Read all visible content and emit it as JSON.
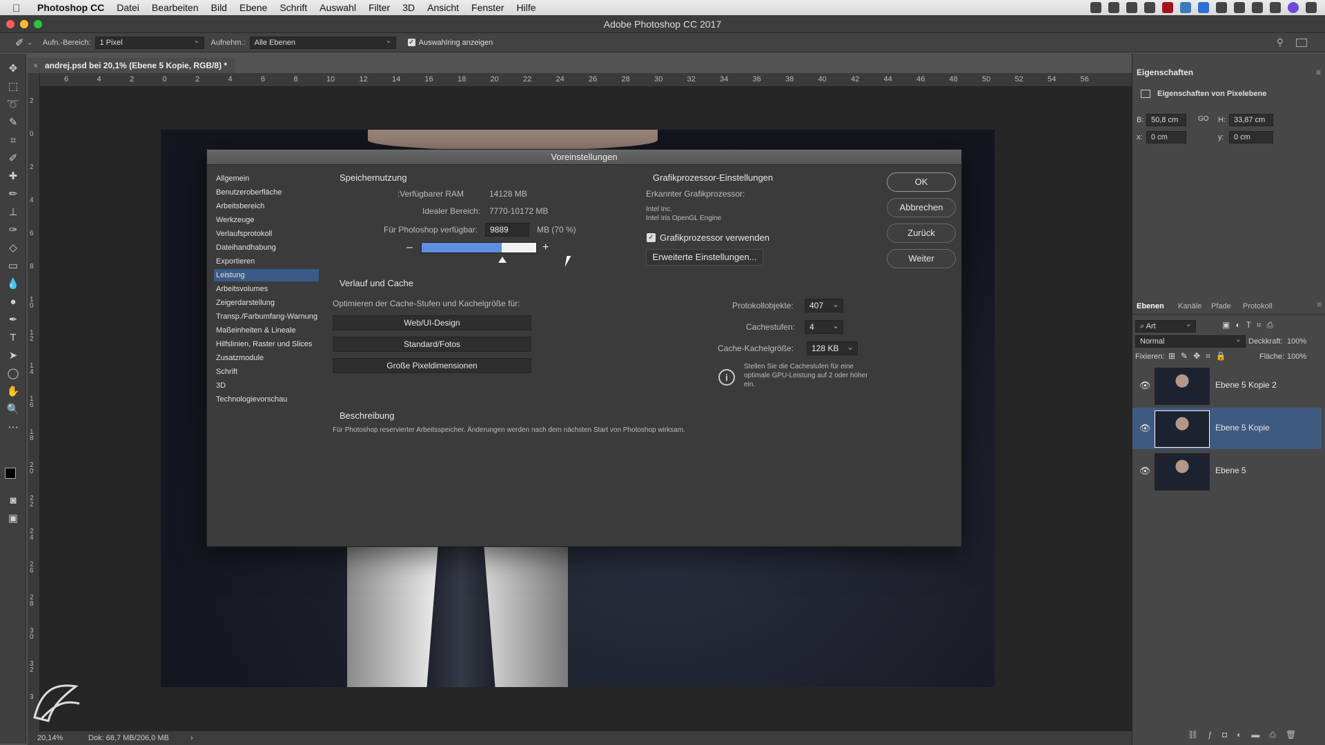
{
  "menubar": {
    "app": "Photoshop CC",
    "items": [
      "Datei",
      "Bearbeiten",
      "Bild",
      "Ebene",
      "Schrift",
      "Auswahl",
      "Filter",
      "3D",
      "Ansicht",
      "Fenster",
      "Hilfe"
    ]
  },
  "window": {
    "title": "Adobe Photoshop CC 2017"
  },
  "options": {
    "sample_size_label": "Aufn.-Bereich:",
    "sample_size_value": "1 Pixel",
    "sample_label": "Aufnehm.:",
    "sample_value": "Alle Ebenen",
    "show_ring_label": "Auswahlring anzeigen"
  },
  "document": {
    "tab": "andrej.psd bei 20,1% (Ebene 5 Kopie, RGB/8) *"
  },
  "ruler_top": [
    "6",
    "4",
    "2",
    "0",
    "2",
    "4",
    "6",
    "8",
    "10",
    "12",
    "14",
    "16",
    "18",
    "20",
    "22",
    "24",
    "26",
    "28",
    "30",
    "32",
    "34",
    "36",
    "38",
    "40",
    "42",
    "44",
    "46",
    "48",
    "50",
    "52",
    "54",
    "56"
  ],
  "ruler_left": [
    "2",
    "0",
    "2",
    "4",
    "6",
    "8",
    "1\n0",
    "1\n2",
    "1\n4",
    "1\n6",
    "1\n8",
    "2\n0",
    "2\n2",
    "2\n4",
    "2\n6",
    "2\n8",
    "3\n0",
    "3\n2",
    "3"
  ],
  "status": {
    "zoom": "20,14%",
    "doc": "Dok: 68,7 MB/206,0 MB",
    "arrow": "›"
  },
  "properties": {
    "title": "Eigenschaften",
    "subtitle": "Eigenschaften von Pixelebene",
    "w_label": "B:",
    "w_value": "50,8 cm",
    "h_label": "H:",
    "h_value": "33,87 cm",
    "x_label": "x:",
    "x_value": "0 cm",
    "y_label": "y:",
    "y_value": "0 cm",
    "link_symbol": "GO"
  },
  "layers_panel": {
    "tabs": [
      "Ebenen",
      "Kanäle",
      "Pfade",
      "Protokoll"
    ],
    "filter": "Art",
    "blend_mode": "Normal",
    "opacity_label": "Deckkraft:",
    "opacity_value": "100%",
    "lock_label": "Fixieren:",
    "fill_label": "Fläche:",
    "fill_value": "100%",
    "layers": [
      {
        "name": "Ebene 5 Kopie 2",
        "selected": false
      },
      {
        "name": "Ebene 5 Kopie",
        "selected": true
      },
      {
        "name": "Ebene 5",
        "selected": false
      }
    ]
  },
  "dialog": {
    "title": "Voreinstellungen",
    "nav": [
      "Allgemein",
      "Benutzeroberfläche",
      "Arbeitsbereich",
      "Werkzeuge",
      "Verlaufsprotokoll",
      "Dateihandhabung",
      "Exportieren",
      "Leistung",
      "Arbeitsvolumes",
      "Zeigerdarstellung",
      "Transp./Farbumfang-Warnung",
      "Maßeinheiten & Lineale",
      "Hilfslinien, Raster und Slices",
      "Zusatzmodule",
      "Schrift",
      "3D",
      "Technologievorschau"
    ],
    "active_nav": "Leistung",
    "memory": {
      "header": "Speichernutzung",
      "ram_label": "Verfügbarer RAM:",
      "ram_value": "14128 MB",
      "ideal_label": "Idealer Bereich:",
      "ideal_value": "7770-10172 MB",
      "ps_label": "Für Photoshop verfügbar:",
      "ps_value": "9889",
      "ps_unit": "MB (70 %)",
      "slider_fraction": 0.7,
      "minus": "–",
      "plus": "+"
    },
    "gpu": {
      "header": "Grafikprozessor-Einstellungen",
      "detected_label": "Erkannter Grafikprozessor:",
      "vendor": "Intel Inc.",
      "engine": "Intel Iris OpenGL Engine",
      "use_label": "Grafikprozessor verwenden",
      "advanced_button": "Erweiterte Einstellungen..."
    },
    "history": {
      "header": "Verlauf und Cache",
      "optimize_label": "Optimieren der Cache-Stufen und Kachelgröße für:",
      "buttons": [
        "Web/UI-Design",
        "Standard/Fotos",
        "Große Pixeldimensionen"
      ],
      "states_label": "Protokollobjekte:",
      "states_value": "407",
      "levels_label": "Cachestufen:",
      "levels_value": "4",
      "tile_label": "Cache-Kachelgröße:",
      "tile_value": "128 KB",
      "info": "Stellen Sie die Cachestufen für eine optimale GPU-Leistung auf 2 oder höher ein."
    },
    "description": {
      "header": "Beschreibung",
      "text": "Für Photoshop reservierter Arbeitsspeicher. Änderungen werden nach dem nächsten Start von Photoshop wirksam."
    },
    "buttons": {
      "ok": "OK",
      "cancel": "Abbrechen",
      "back": "Zurück",
      "next": "Weiter"
    }
  }
}
